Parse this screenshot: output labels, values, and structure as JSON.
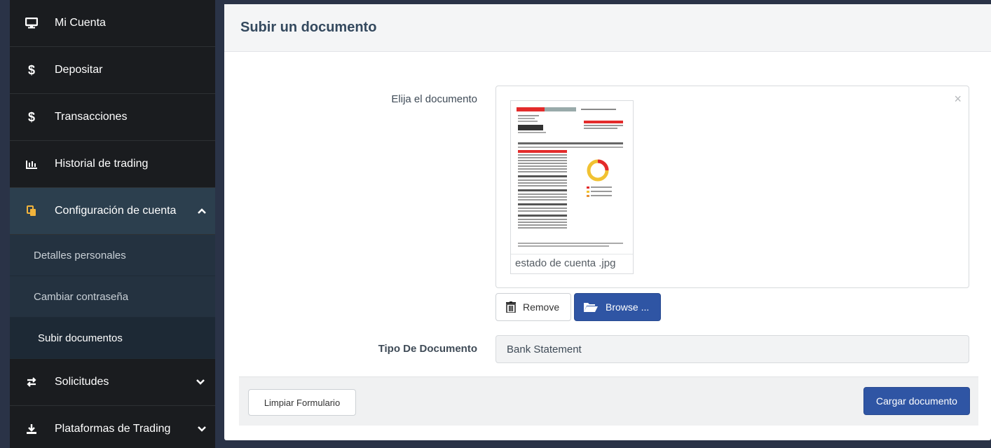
{
  "sidebar": {
    "items": [
      {
        "label": "Mi Cuenta",
        "icon": "monitor-icon"
      },
      {
        "label": "Depositar",
        "icon": "dollar-icon"
      },
      {
        "label": "Transacciones",
        "icon": "dollar-icon"
      },
      {
        "label": "Historial de trading",
        "icon": "bar-chart-icon"
      },
      {
        "label": "Configuración de cuenta",
        "icon": "copy-icon"
      }
    ],
    "submenu": [
      {
        "label": "Detalles personales"
      },
      {
        "label": "Cambiar contraseña"
      },
      {
        "label": "Subir documentos"
      }
    ],
    "bottom_items": [
      {
        "label": "Solicitudes",
        "icon": "exchange-icon"
      },
      {
        "label": "Plataformas de Trading",
        "icon": "download-icon"
      }
    ]
  },
  "main": {
    "title": "Subir un documento",
    "document_label": "Elija el documento",
    "file_name": "estado de cuenta .jpg",
    "remove_label": "Remove",
    "browse_label": "Browse ...",
    "type_label": "Tipo De Documento",
    "type_value": "Bank Statement",
    "clear_label": "Limpiar Formulario",
    "upload_label": "Cargar documento"
  },
  "colors": {
    "sidebar_bg": "#1a1c1f",
    "active_bg": "#2c3f4e",
    "primary_button": "#2f55a4",
    "background": "#2a3347"
  }
}
